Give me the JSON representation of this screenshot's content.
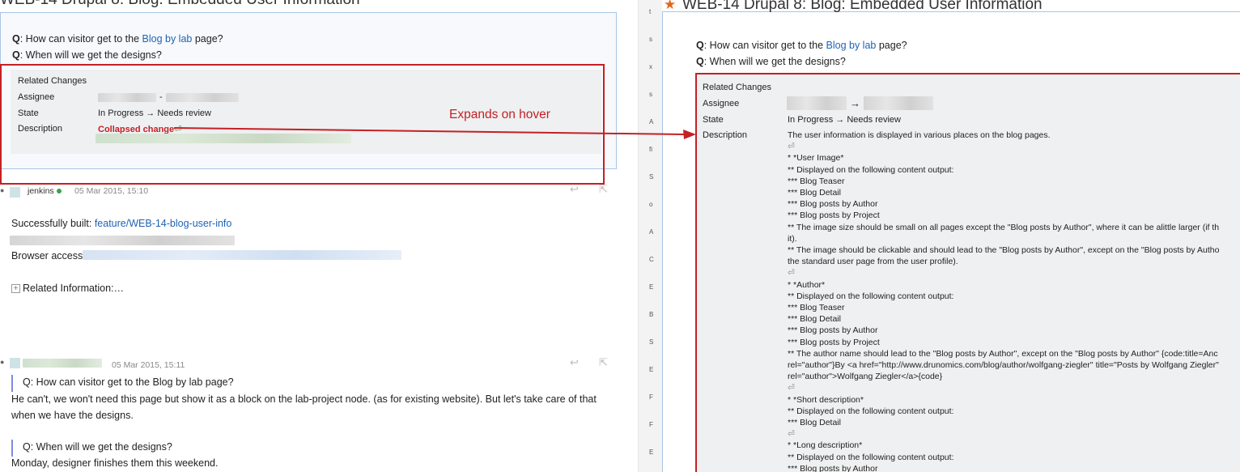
{
  "left": {
    "title": "WEB-14   Drupal 8: Blog: Embedded User Information",
    "q1_prefix": "Q",
    "q1_text_a": ": How can visitor get to the ",
    "q1_link": "Blog by lab",
    "q1_text_b": " page?",
    "q2_prefix": "Q",
    "q2_text": ": When will we get the designs?",
    "related_changes": "Related Changes",
    "assignee_label": "Assignee",
    "assignee_sep": "-",
    "state_label": "State",
    "state_value": "In Progress → Needs review",
    "description_label": "Description",
    "collapsed_change": "Collapsed change",
    "collapsed_glyph": "⏎",
    "annotation": "Expands on hover",
    "comment1": {
      "author": "jenkins",
      "date": "05 Mar 2015, 15:10",
      "built_text": "Successfully built: ",
      "built_link": "feature/WEB-14-blog-user-info",
      "browser_access": "Browser access:",
      "related_info": "Related Information:…"
    },
    "comment2": {
      "date": "05 Mar 2015, 15:11",
      "quote1": "Q: How can visitor get to the Blog by lab page?",
      "answer1a": "He can't, we won't need this page but show it as a block on the lab-project node. (as for existing website). But let's take care of that",
      "answer1b": "when we have the designs.",
      "quote2": "Q: When will we get the designs?",
      "answer2": "Monday, designer finishes them this weekend."
    }
  },
  "right": {
    "title": "WEB-14    Drupal 8: Blog: Embedded User Information",
    "q1_prefix": "Q",
    "q1_text_a": ": How can visitor get to the ",
    "q1_link": "Blog by lab",
    "q1_text_b": " page?",
    "q2_prefix": "Q",
    "q2_text": ": When will we get the designs?",
    "related_changes": "Related Changes",
    "assignee_label": "Assignee",
    "assignee_arrow": "→",
    "state_label": "State",
    "state_value": "In Progress → Needs review",
    "description_label": "Description",
    "description_lines": [
      "The user information is displayed in various places on the blog pages.",
      "⏎",
      "* *User Image*",
      "** Displayed on the following content output:",
      "*** Blog Teaser",
      "*** Blog Detail",
      "*** Blog posts by Author",
      "*** Blog posts by Project",
      "** The image size should be small on all pages except the \"Blog posts by Author\", where it can be alittle larger (if th",
      "it).",
      "** The image should be clickable and should lead to the \"Blog posts by Author\", except on the \"Blog posts by Autho",
      "the standard user page from the user profile).",
      "⏎",
      "* *Author*",
      "** Displayed on the following content output:",
      "*** Blog Teaser",
      "*** Blog Detail",
      "*** Blog posts by Author",
      "*** Blog posts by Project",
      "** The author name should lead to the \"Blog posts by Author\", except on the \"Blog posts by Author\" {code:title=Anc",
      "rel=\"author\"}By <a href=\"http://www.drunomics.com/blog/author/wolfgang-ziegler\" title=\"Posts by Wolfgang Ziegler\"",
      "rel=\"author\">Wolfgang Ziegler</a>{code}",
      "⏎",
      "* *Short description*",
      "** Displayed on the following content output:",
      "*** Blog Detail",
      "⏎",
      "* *Long description*",
      "** Displayed on the following content output:",
      "*** Blog posts by Author"
    ]
  },
  "strip_chars": [
    "t",
    "s",
    "x",
    "s",
    "A",
    "fi",
    "S",
    "o",
    "A",
    "C",
    "E",
    "B",
    "S",
    "E",
    "F",
    "F",
    "E"
  ],
  "colors": {
    "annotation_red": "#c42025",
    "link_blue": "#1e63b5",
    "star_orange": "#e8641a"
  }
}
